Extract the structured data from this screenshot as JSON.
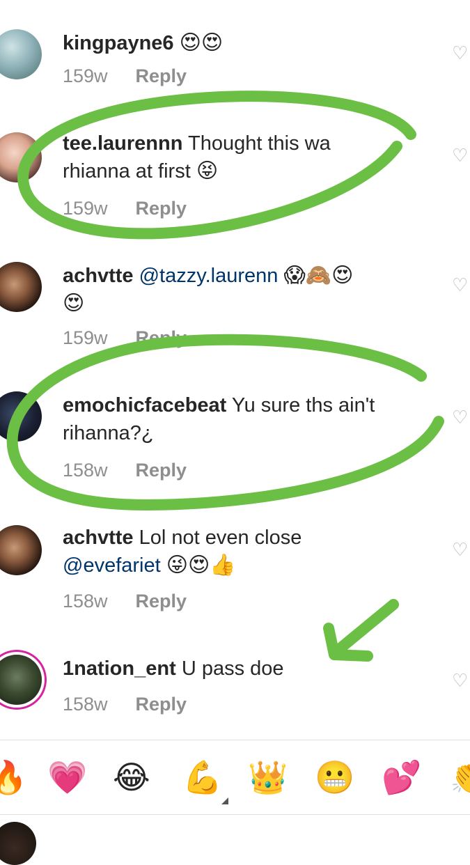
{
  "comments": [
    {
      "username": "kingpayne6",
      "text": "",
      "emoji": "😍😍",
      "time": "159w",
      "reply": "Reply"
    },
    {
      "username": "tee.laurennn",
      "text": "Thought this wa",
      "line2": "rhianna at first",
      "emoji": "😝",
      "time": "159w",
      "reply": "Reply"
    },
    {
      "username": "achvtte",
      "mention": "@tazzy.laurenn",
      "emoji": "😱🙈😍",
      "line2_emoji": "😍",
      "time": "159w",
      "reply": "Reply"
    },
    {
      "username": "emochicfacebeat",
      "text": "Yu sure ths ain't",
      "line2": "rihanna?¿",
      "time": "158w",
      "reply": "Reply"
    },
    {
      "username": "achvtte",
      "text": "Lol not even close",
      "mention": "@evefariet",
      "emoji": "😜😍👍",
      "time": "158w",
      "reply": "Reply"
    },
    {
      "username": "1nation_ent",
      "text": "U pass doe",
      "time": "158w",
      "reply": "Reply"
    }
  ],
  "emoji_bar": [
    "🔥",
    "💗",
    "😂",
    "💪",
    "👑",
    "😬",
    "💕",
    "👏"
  ],
  "colors": {
    "annotation_green": "#6cbf45",
    "username": "#262626",
    "meta": "#8e8e8e",
    "mention": "#003569"
  },
  "icons": {
    "like": "heart-outline-icon"
  }
}
